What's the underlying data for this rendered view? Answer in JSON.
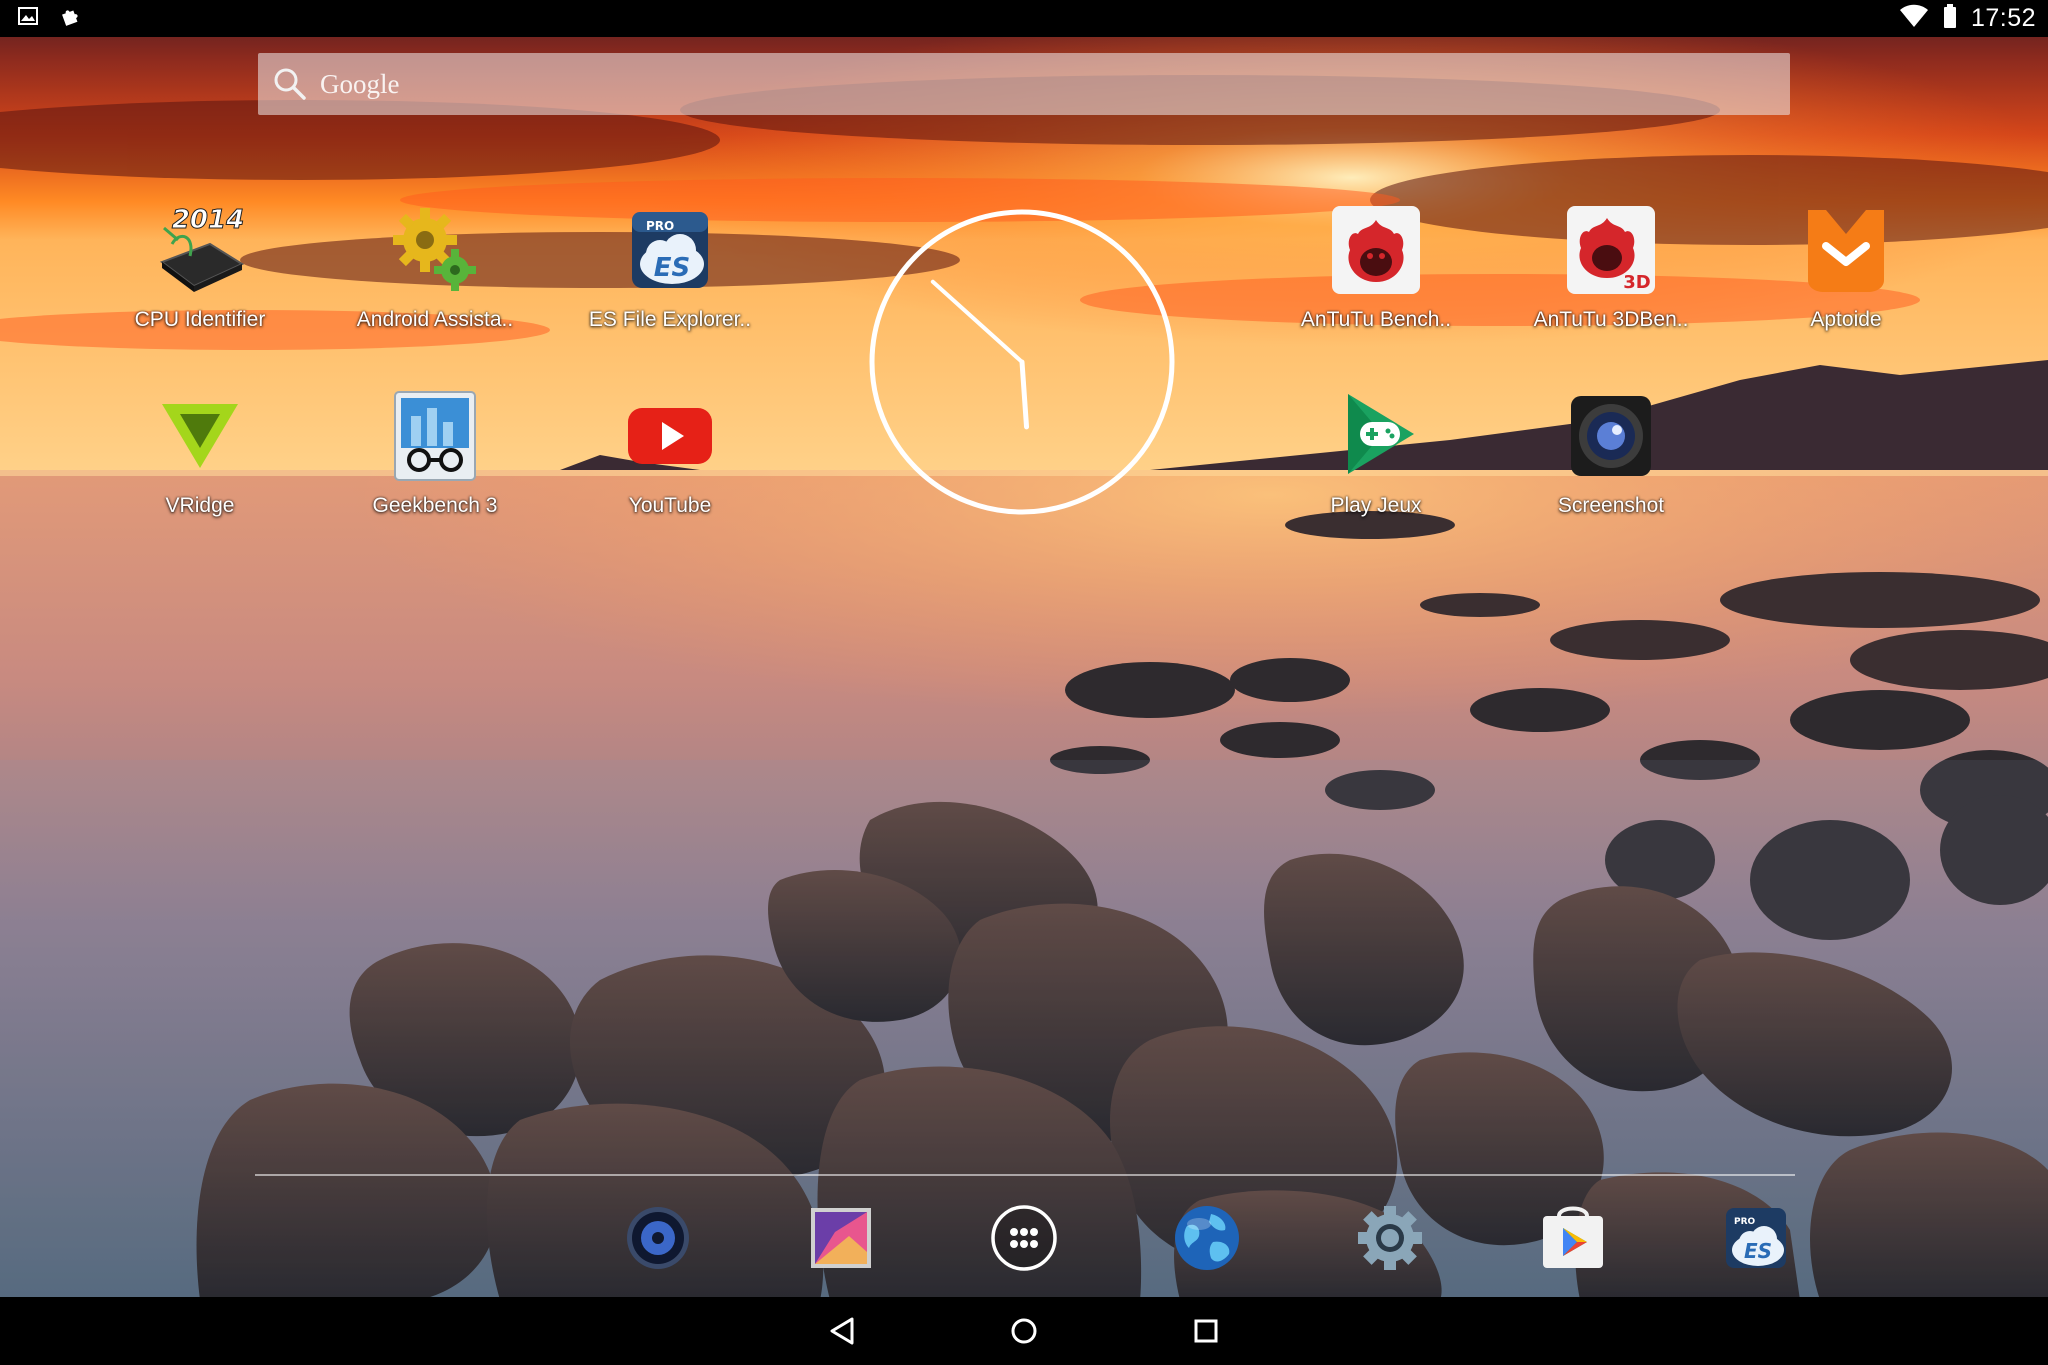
{
  "status_bar": {
    "time": "17:52",
    "left_icons": [
      "image-notification-icon",
      "puzzle-notification-icon"
    ],
    "right_icons": [
      "wifi-icon",
      "battery-icon"
    ]
  },
  "search": {
    "placeholder": "Google",
    "icon": "search-icon"
  },
  "apps": [
    {
      "label": "CPU Identifier",
      "icon": "cpu-identifier-icon",
      "badge": "2014"
    },
    {
      "label": "Android Assista..",
      "icon": "android-assistant-gear-icon"
    },
    {
      "label": "ES File Explorer..",
      "icon": "es-file-explorer-icon",
      "badge": "PRO"
    },
    {
      "label": "AnTuTu Bench..",
      "icon": "antutu-benchmark-icon"
    },
    {
      "label": "AnTuTu 3DBen..",
      "icon": "antutu-3d-benchmark-icon",
      "badge": "3D"
    },
    {
      "label": "Aptoide",
      "icon": "aptoide-icon"
    },
    {
      "label": "VRidge",
      "icon": "vridge-icon"
    },
    {
      "label": "Geekbench 3",
      "icon": "geekbench-icon"
    },
    {
      "label": "YouTube",
      "icon": "youtube-icon"
    },
    {
      "label": "Play Jeux",
      "icon": "play-games-icon"
    },
    {
      "label": "Screenshot",
      "icon": "screenshot-camera-icon"
    }
  ],
  "clock_widget": {
    "type": "analog",
    "hour": 5,
    "minute": 52
  },
  "dock": [
    {
      "name": "music-player",
      "icon": "speaker-icon"
    },
    {
      "name": "gallery",
      "icon": "gallery-icon"
    },
    {
      "name": "app-drawer",
      "icon": "app-drawer-icon"
    },
    {
      "name": "browser",
      "icon": "globe-icon"
    },
    {
      "name": "settings",
      "icon": "settings-gear-icon"
    },
    {
      "name": "play-store",
      "icon": "play-store-icon"
    },
    {
      "name": "es-file-explorer",
      "icon": "es-file-explorer-icon"
    }
  ],
  "nav": {
    "buttons": [
      "back-icon",
      "home-icon",
      "recents-icon"
    ]
  },
  "colors": {
    "status_bar_bg": "#000000",
    "youtube_red": "#e62117",
    "aptoide_orange": "#f57c16",
    "antutu_red": "#d5262b",
    "vridge_green": "#a4d61b",
    "sky_orange": "#ff7a1c"
  }
}
